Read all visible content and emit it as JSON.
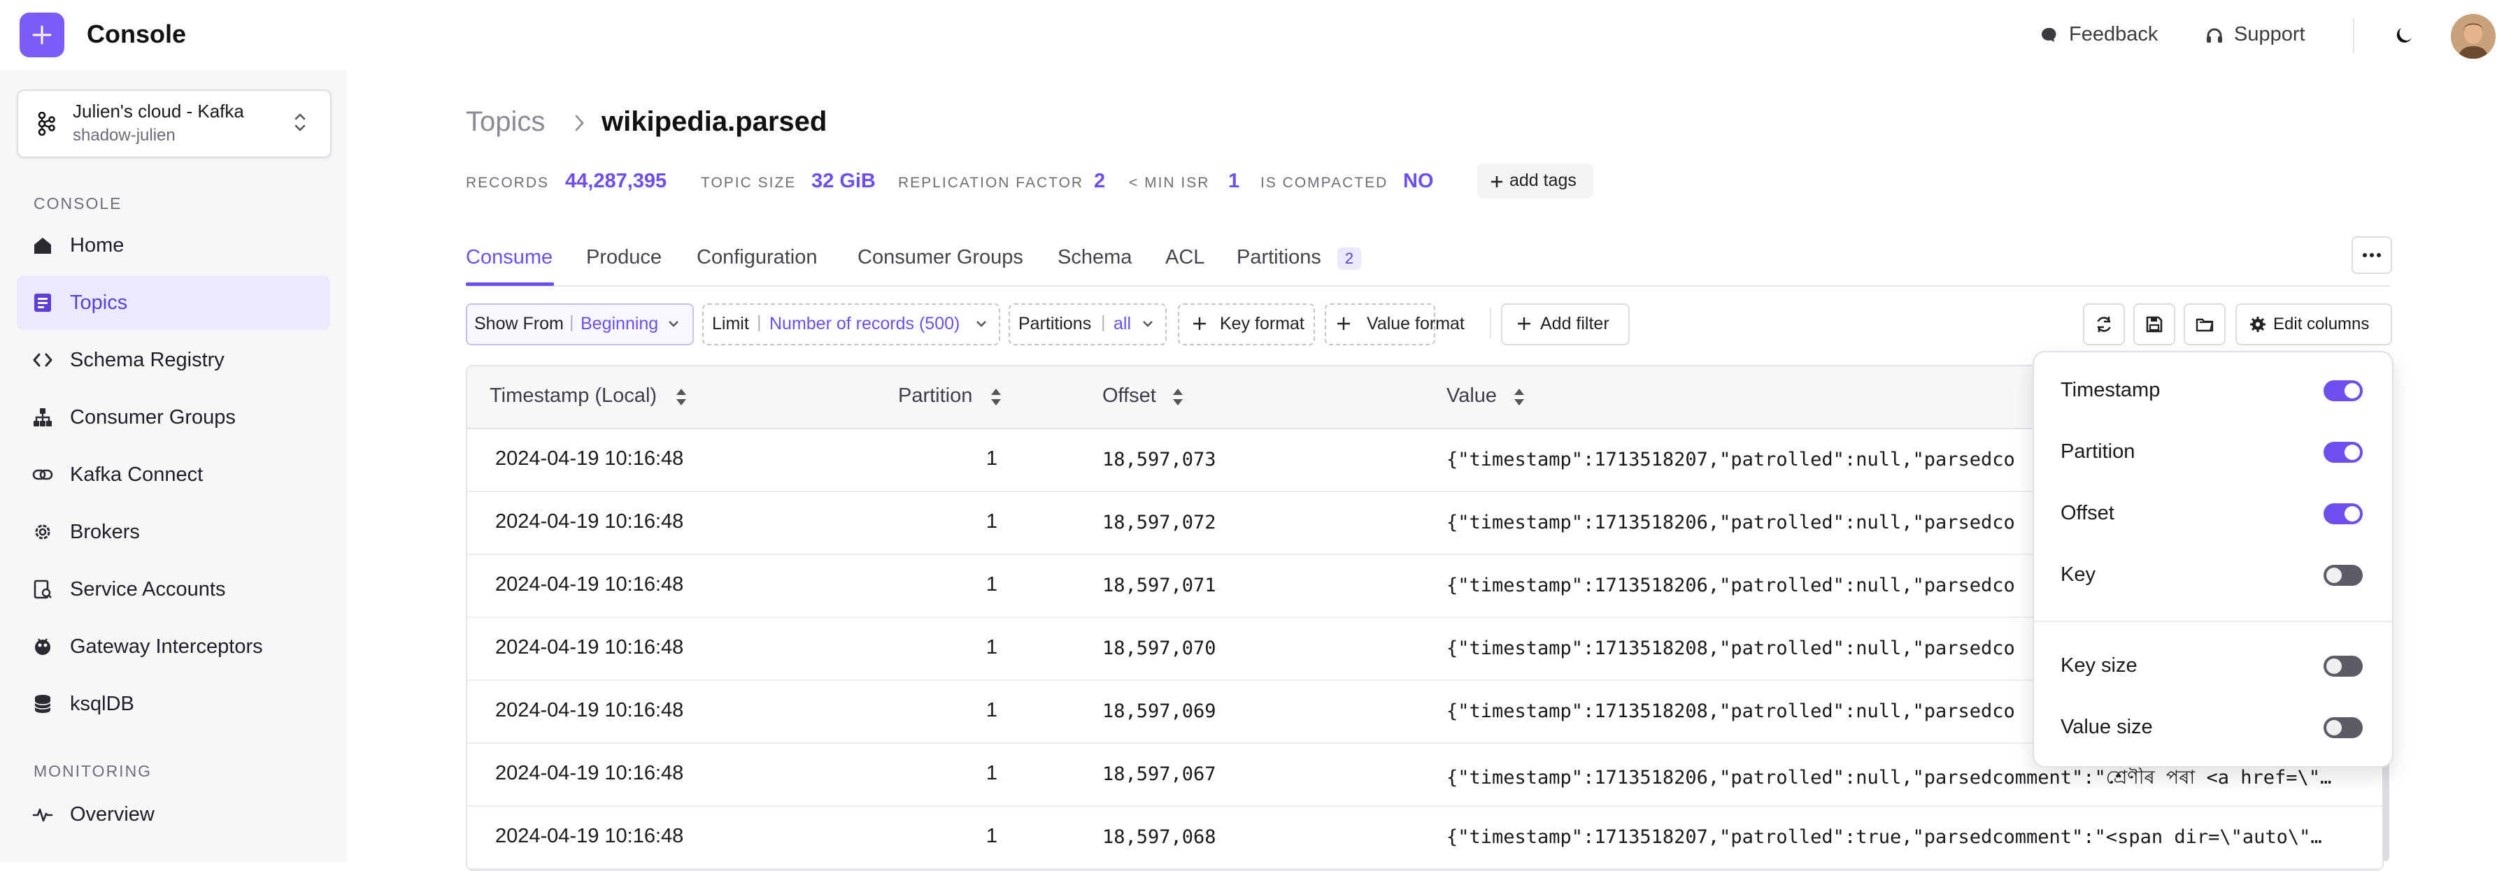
{
  "app": {
    "title": "Console"
  },
  "header": {
    "feedback_label": "Feedback",
    "support_label": "Support"
  },
  "cluster": {
    "name": "Julien's cloud - Kafka",
    "environment": "shadow-julien"
  },
  "sidebar": {
    "section_console": "CONSOLE",
    "section_monitoring": "MONITORING",
    "items": [
      {
        "label": "Home",
        "icon": "home-icon"
      },
      {
        "label": "Topics",
        "icon": "topics-icon",
        "active": true
      },
      {
        "label": "Schema Registry",
        "icon": "code-icon"
      },
      {
        "label": "Consumer Groups",
        "icon": "hierarchy-icon"
      },
      {
        "label": "Kafka Connect",
        "icon": "link-icon"
      },
      {
        "label": "Brokers",
        "icon": "gear-icon"
      },
      {
        "label": "Service Accounts",
        "icon": "account-icon"
      },
      {
        "label": "Gateway Interceptors",
        "icon": "interceptor-icon"
      },
      {
        "label": "ksqlDB",
        "icon": "database-icon"
      },
      {
        "label": "Overview",
        "icon": "pulse-icon"
      }
    ]
  },
  "breadcrumb": {
    "root": "Topics",
    "current": "wikipedia.parsed"
  },
  "stats": {
    "records_label": "RECORDS",
    "records_value": "44,287,395",
    "size_label": "TOPIC SIZE",
    "size_value": "32 GiB",
    "replication_label": "REPLICATION FACTOR",
    "replication_value": "2",
    "min_isr_label": "< MIN ISR",
    "min_isr_value": "1",
    "compacted_label": "IS COMPACTED",
    "compacted_value": "NO",
    "add_tags_label": "add tags"
  },
  "tabs": [
    {
      "label": "Consume",
      "active": true
    },
    {
      "label": "Produce"
    },
    {
      "label": "Configuration"
    },
    {
      "label": "Consumer Groups"
    },
    {
      "label": "Schema"
    },
    {
      "label": "ACL"
    },
    {
      "label": "Partitions",
      "badge": "2"
    }
  ],
  "toolbar": {
    "show_from_label": "Show From",
    "show_from_value": "Beginning",
    "limit_label": "Limit",
    "limit_value": "Number of records (500)",
    "partitions_label": "Partitions",
    "partitions_value": "all",
    "key_format_label": "Key format",
    "value_format_label": "Value format",
    "add_filter_label": "Add filter",
    "edit_columns_label": "Edit columns"
  },
  "table": {
    "columns": [
      "Timestamp (Local)",
      "Partition",
      "Offset",
      "Value"
    ],
    "rows": [
      {
        "timestamp": "2024-04-19 10:16:48",
        "partition": "1",
        "offset": "18,597,073",
        "value": "{\"timestamp\":1713518207,\"patrolled\":null,\"parsedco"
      },
      {
        "timestamp": "2024-04-19 10:16:48",
        "partition": "1",
        "offset": "18,597,072",
        "value": "{\"timestamp\":1713518206,\"patrolled\":null,\"parsedco"
      },
      {
        "timestamp": "2024-04-19 10:16:48",
        "partition": "1",
        "offset": "18,597,071",
        "value": "{\"timestamp\":1713518206,\"patrolled\":null,\"parsedco"
      },
      {
        "timestamp": "2024-04-19 10:16:48",
        "partition": "1",
        "offset": "18,597,070",
        "value": "{\"timestamp\":1713518208,\"patrolled\":null,\"parsedco"
      },
      {
        "timestamp": "2024-04-19 10:16:48",
        "partition": "1",
        "offset": "18,597,069",
        "value": "{\"timestamp\":1713518208,\"patrolled\":null,\"parsedco"
      },
      {
        "timestamp": "2024-04-19 10:16:48",
        "partition": "1",
        "offset": "18,597,067",
        "value": "{\"timestamp\":1713518206,\"patrolled\":null,\"parsedcomment\":\"শ্ৰেণীৰ পৰা <a href=\\\"…"
      },
      {
        "timestamp": "2024-04-19 10:16:48",
        "partition": "1",
        "offset": "18,597,068",
        "value": "{\"timestamp\":1713518207,\"patrolled\":true,\"parsedcomment\":\"<span dir=\\\"auto\\\"…"
      }
    ]
  },
  "columns_popover": {
    "options": [
      {
        "label": "Timestamp",
        "enabled": true
      },
      {
        "label": "Partition",
        "enabled": true
      },
      {
        "label": "Offset",
        "enabled": true
      },
      {
        "label": "Key",
        "enabled": false
      },
      {
        "label": "Key size",
        "enabled": false
      },
      {
        "label": "Value size",
        "enabled": false
      }
    ]
  },
  "colors": {
    "accent": "#6d4ff0",
    "accent_light": "#ece9fd",
    "border": "#e3e3e8",
    "sidebar_bg": "#f7f7f9"
  }
}
